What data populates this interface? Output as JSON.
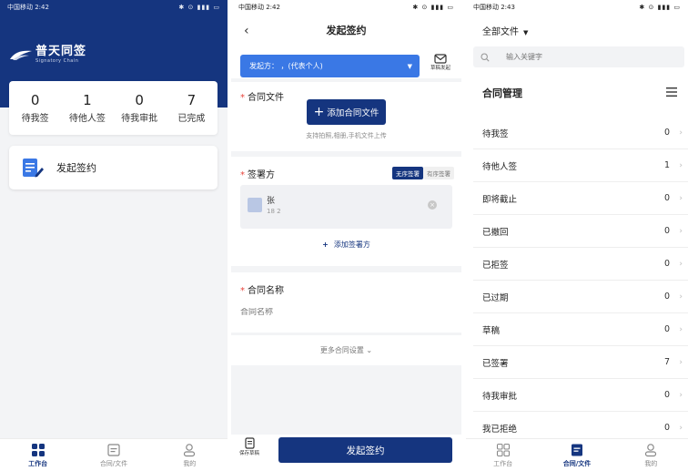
{
  "colors": {
    "primary": "#15357f",
    "accent_blue": "#3a78e5",
    "required": "#e8453c"
  },
  "panel1": {
    "status_left": "中国移动 2:42",
    "status_right": "✱ ⊙ ▮▮▮ ▭",
    "logo_main": "普天同签",
    "logo_sub": "Signatory Chain",
    "stats": [
      {
        "num": "0",
        "label": "待我签"
      },
      {
        "num": "1",
        "label": "待他人签"
      },
      {
        "num": "0",
        "label": "待我审批"
      },
      {
        "num": "7",
        "label": "已完成"
      }
    ],
    "initiate_label": "发起签约",
    "tabs": [
      {
        "label": "工作台",
        "icon": "grid-icon"
      },
      {
        "label": "合同/文件",
        "icon": "document-icon"
      },
      {
        "label": "我的",
        "icon": "user-icon"
      }
    ]
  },
  "panel2": {
    "status_left": "中国移动 2:42",
    "status_right": "✱ ⊙ ▮▮▮ ▭",
    "back": "‹",
    "title": "发起签约",
    "initiator": "发起方：  ，(代表个人)",
    "initiator_arrow": "▼",
    "draft_label": "草稿发起",
    "file_section": "合同文件",
    "add_file": "添加合同文件",
    "plus": "+",
    "file_hint": "支持拍照,相册,手机文件上传",
    "signer_section": "签署方",
    "order_on": "无序签署",
    "order_off": "有序签署",
    "signer_name": "张",
    "signer_phone": "18      2",
    "remove": "×",
    "add_signer": "添加签署方",
    "name_section": "合同名称",
    "name_placeholder": "合同名称",
    "more_settings": "更多合同设置 ⌄",
    "save_draft": "保存草稿",
    "submit": "发起签约",
    "required_mark": "*"
  },
  "panel3": {
    "status_left": "中国移动 2:43",
    "status_right": "✱ ⊙ ▮▮▮ ▭",
    "filter": "全部文件",
    "filter_caret": "▼",
    "search_placeholder": "输入关键字",
    "mgmt_title": "合同管理",
    "rows": [
      {
        "label": "待我签",
        "count": "0"
      },
      {
        "label": "待他人签",
        "count": "1"
      },
      {
        "label": "即将截止",
        "count": "0"
      },
      {
        "label": "已撤回",
        "count": "0"
      },
      {
        "label": "已拒签",
        "count": "0"
      },
      {
        "label": "已过期",
        "count": "0"
      },
      {
        "label": "草稿",
        "count": "0"
      },
      {
        "label": "已签署",
        "count": "7"
      },
      {
        "label": "待我审批",
        "count": "0"
      },
      {
        "label": "我已拒绝",
        "count": "0"
      }
    ],
    "chevron": "›",
    "tabs": [
      {
        "label": "工作台",
        "icon": "grid-icon"
      },
      {
        "label": "合同/文件",
        "icon": "document-icon"
      },
      {
        "label": "我的",
        "icon": "user-icon"
      }
    ]
  }
}
